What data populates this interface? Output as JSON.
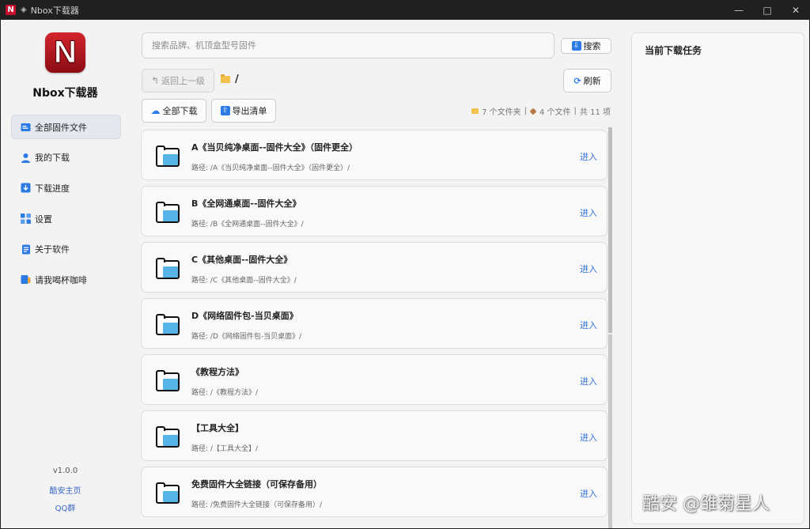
{
  "titlebar": {
    "title": "Nbox下载器",
    "logo_letter": "N"
  },
  "window_controls": {
    "minimize": "—",
    "maximize": "□",
    "close": "✕"
  },
  "sidebar": {
    "app_name": "Nbox下载器",
    "logo_letter": "N",
    "items": [
      {
        "label": "全部固件文件",
        "icon": "folder-list-icon",
        "active": true
      },
      {
        "label": "我的下载",
        "icon": "user-icon",
        "active": false
      },
      {
        "label": "下载进度",
        "icon": "download-icon",
        "active": false
      },
      {
        "label": "设置",
        "icon": "settings-grid-icon",
        "active": false
      },
      {
        "label": "关于软件",
        "icon": "document-icon",
        "active": false
      },
      {
        "label": "请我喝杯咖啡",
        "icon": "coffee-icon",
        "active": false
      }
    ],
    "version": "v1.0.0",
    "link_home": "酷安主页",
    "link_qq": "QQ群"
  },
  "search": {
    "placeholder": "搜索品牌、机顶盒型号固件",
    "value": "",
    "button": "搜索"
  },
  "toolbar": {
    "back": "返回上一级",
    "refresh": "刷新",
    "download_all": "全部下载",
    "export": "导出清单",
    "current_path": "/"
  },
  "stats": {
    "folders": "7 个文件夹",
    "files": "4 个文件",
    "total": "共 11 项"
  },
  "list": {
    "enter_label": "进入",
    "path_prefix": "路径:",
    "items": [
      {
        "title": "A《当贝纯净桌面--固件大全》（固件更全）",
        "path": "/A《当贝纯净桌面--固件大全》（固件更全）/"
      },
      {
        "title": "B《全网通桌面--固件大全》",
        "path": "/B《全网通桌面--固件大全》/"
      },
      {
        "title": "C《其他桌面--固件大全》",
        "path": "/C《其他桌面--固件大全》/"
      },
      {
        "title": "D《网络固件包-当贝桌面》",
        "path": "/D《网络固件包-当贝桌面》/"
      },
      {
        "title": "《教程方法》",
        "path": "/《教程方法》/"
      },
      {
        "title": "【工具大全】",
        "path": "/【工具大全】/"
      },
      {
        "title": "免费固件大全链接（可保存备用）",
        "path": "/免费固件大全链接（可保存备用）/"
      }
    ]
  },
  "task_panel": {
    "title": "当前下载任务"
  },
  "watermark": "酷安 @雏菊星人",
  "colors": {
    "accent": "#2c7be5",
    "link": "#3a68c9",
    "brand_red": "#c8102e",
    "folder_blue": "#56b4e9"
  }
}
